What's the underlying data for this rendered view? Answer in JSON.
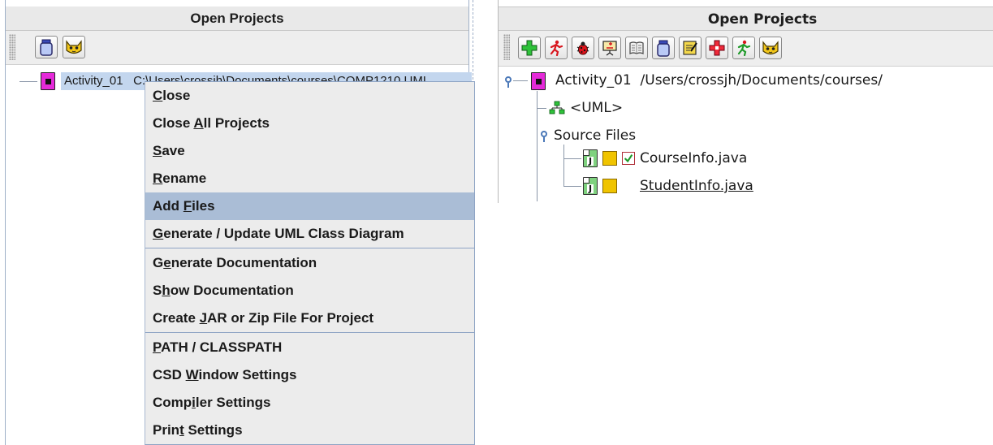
{
  "left": {
    "header_title": "Open Projects",
    "toolbar": [
      {
        "icon": "jar-icon"
      },
      {
        "icon": "cat-icon"
      }
    ],
    "tree": {
      "project_label": "Activity_01",
      "project_suffix": "C:\\Users\\crossjh\\Documents\\courses\\COMP1210 UML"
    },
    "context_menu": {
      "items": [
        {
          "pre": "",
          "mn": "C",
          "post": "lose"
        },
        {
          "pre": "Close ",
          "mn": "A",
          "post": "ll Projects"
        },
        {
          "pre": "",
          "mn": "S",
          "post": "ave"
        },
        {
          "pre": "",
          "mn": "R",
          "post": "ename"
        },
        {
          "pre": "Add ",
          "mn": "F",
          "post": "iles"
        },
        {
          "pre": "",
          "mn": "G",
          "post": "enerate / Update UML Class Diagram"
        },
        {
          "pre": "G",
          "mn": "e",
          "post": "nerate Documentation"
        },
        {
          "pre": "S",
          "mn": "h",
          "post": "ow Documentation"
        },
        {
          "pre": "Create ",
          "mn": "J",
          "post": "AR or Zip File For Project"
        },
        {
          "pre": "",
          "mn": "P",
          "post": "ATH / CLASSPATH"
        },
        {
          "pre": "CSD ",
          "mn": "W",
          "post": "indow Settings"
        },
        {
          "pre": "Comp",
          "mn": "i",
          "post": "ler Settings"
        },
        {
          "pre": "Prin",
          "mn": "t",
          "post": " Settings"
        }
      ],
      "hovered": "Add Files"
    }
  },
  "right": {
    "header_title": "Open Projects",
    "toolbar": [
      {
        "icon": "green-plus-icon"
      },
      {
        "icon": "runner-icon"
      },
      {
        "icon": "bug-icon"
      },
      {
        "icon": "presentation-icon"
      },
      {
        "icon": "book-icon"
      },
      {
        "icon": "jar-icon"
      },
      {
        "icon": "notepad-icon"
      },
      {
        "icon": "red-plus-icon"
      },
      {
        "icon": "green-runner-icon"
      },
      {
        "icon": "cat-icon"
      }
    ],
    "tree": {
      "project_label": "Activity_01",
      "project_path": "/Users/crossjh/Documents/courses/",
      "uml_label": "<UML>",
      "source_folder": "Source Files",
      "files": [
        {
          "name": "CourseInfo.java",
          "checked": true
        },
        {
          "name": "StudentInfo.java",
          "checked": false
        }
      ]
    }
  },
  "colors": {
    "menu_bg": "#ececec",
    "menu_hover": "#aabdd6",
    "selection": "#c3d6ee",
    "project_icon": "#e52ad9",
    "java_icon": "#7fd27f",
    "status_yellow": "#f0c400"
  }
}
